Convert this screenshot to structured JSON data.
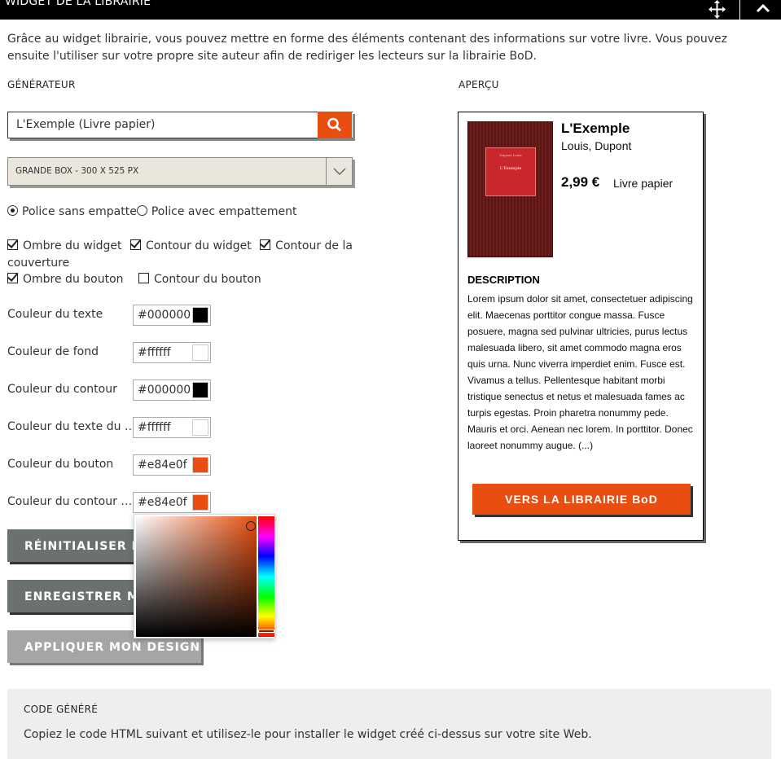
{
  "header": {
    "title": "WIDGET DE LA LIBRAIRIE",
    "move_icon": "move-icon",
    "collapse_icon": "chevron-up-icon"
  },
  "intro": "Grâce au widget librairie, vous pouvez mettre en forme des éléments contenant des informations sur votre livre. Vous pouvez ensuite l'utiliser sur votre propre site auteur afin de rediriger les lecteurs sur la librairie BoD.",
  "generator": {
    "title": "GÉNÉRATEUR",
    "search_value": "L'Exemple (Livre papier)",
    "search_icon": "search-icon",
    "size_select": "GRANDE BOX - 300 X 525 PX",
    "font_options": [
      {
        "label": "Police sans empatte",
        "selected": true
      },
      {
        "label": "Police avec empattement",
        "selected": false
      }
    ],
    "checkboxes": [
      {
        "label": "Ombre du widget",
        "checked": true
      },
      {
        "label": "Contour du widget",
        "checked": true
      },
      {
        "label": "Contour de la couverture",
        "checked": true
      },
      {
        "label": "Ombre du bouton",
        "checked": true
      },
      {
        "label": "Contour du bouton",
        "checked": false
      }
    ],
    "colors": [
      {
        "label": "Couleur du texte",
        "value": "#000000",
        "swatch": "#000000"
      },
      {
        "label": "Couleur de fond",
        "value": "#ffffff",
        "swatch": "#ffffff"
      },
      {
        "label": "Couleur du contour",
        "value": "#000000",
        "swatch": "#000000"
      },
      {
        "label": "Couleur du texte du …",
        "value": "#ffffff",
        "swatch": "#ffffff"
      },
      {
        "label": "Couleur du bouton",
        "value": "#e84e0f",
        "swatch": "#e84e0f"
      },
      {
        "label": "Couleur du contour …",
        "value": "#e84e0f",
        "swatch": "#e84e0f"
      }
    ],
    "buttons": {
      "reset": "RÉINITIALISER LE",
      "save": "ENREGISTRER MO",
      "apply": "APPLIQUER MON DESIGN"
    }
  },
  "preview": {
    "title": "APERÇU",
    "book": {
      "cover_title": "L'Exemple",
      "cover_author": "Dupont Louis",
      "title": "L'Exemple",
      "author": "Louis, Dupont",
      "price": "2,99  €",
      "format": "Livre papier"
    },
    "description_title": "DESCRIPTION",
    "description": "Lorem ipsum dolor sit amet, consectetuer adipiscing elit. Maecenas porttitor congue massa. Fusce posuere, magna sed pulvinar ultricies, purus lectus malesuada libero, sit amet commodo magna eros quis urna. Nunc viverra imperdiet enim. Fusce est. Vivamus a tellus. Pellentesque habitant morbi tristique senectus et netus et malesuada fames ac turpis egestas. Proin pharetra nonummy pede. Mauris et orci. Aenean nec lorem. In porttitor. Donec laoreet nonummy augue. (...)",
    "shop_button": "VERS LA LIBRAIRIE BoD"
  },
  "code": {
    "title": "CODE GÉNÉRÉ",
    "text": "Copiez le code HTML suivant et utilisez-le pour installer le widget créé ci-dessus sur votre site Web."
  },
  "theme": {
    "accent": "#e84e0f",
    "button_dark": "#6b716e",
    "button_light": "#a3a6a4"
  }
}
